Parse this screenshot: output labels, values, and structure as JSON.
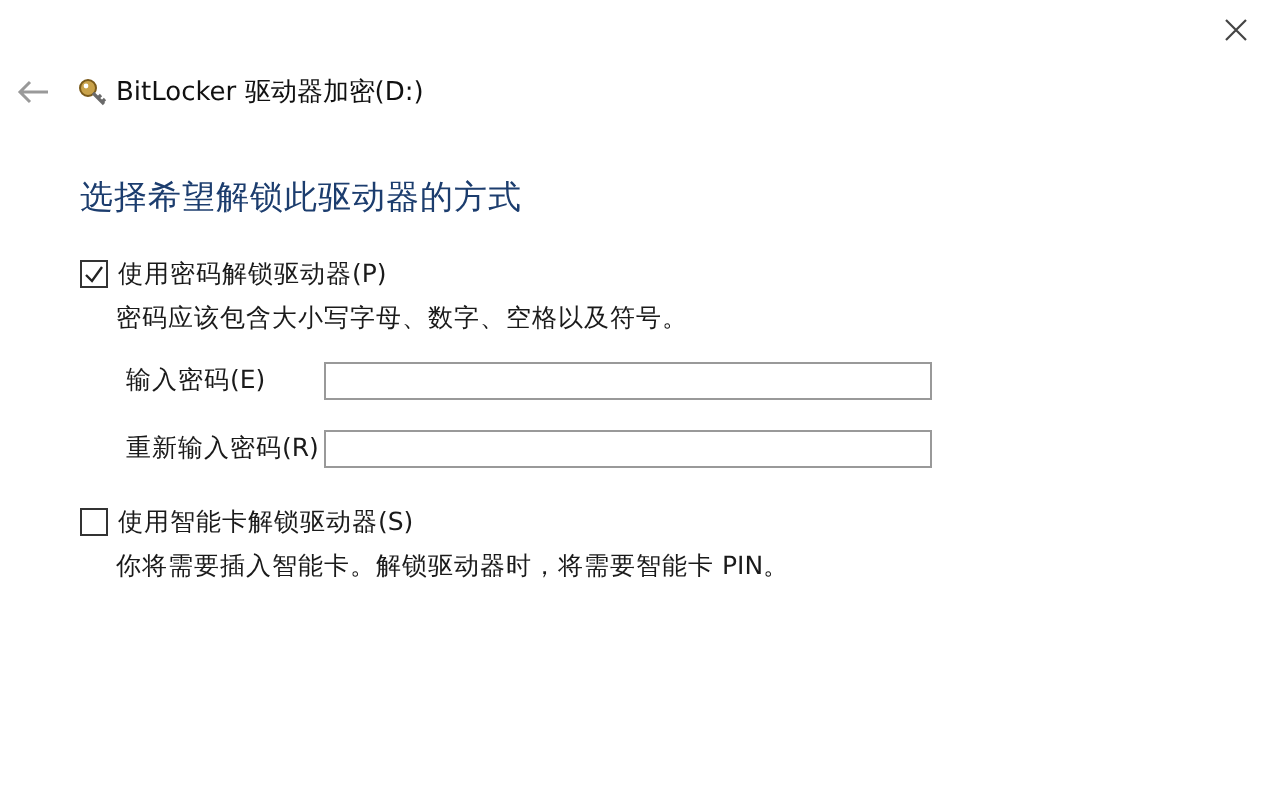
{
  "window": {
    "title": "BitLocker 驱动器加密(D:)"
  },
  "heading": "选择希望解锁此驱动器的方式",
  "options": [
    {
      "label": "使用密码解锁驱动器(P)",
      "checked": true,
      "description": "密码应该包含大小写字母、数字、空格以及符号。",
      "fields": [
        {
          "label": "输入密码(E)"
        },
        {
          "label": "重新输入密码(R)"
        }
      ]
    },
    {
      "label": "使用智能卡解锁驱动器(S)",
      "checked": false,
      "description": "你将需要插入智能卡。解锁驱动器时，将需要智能卡 PIN。"
    }
  ]
}
